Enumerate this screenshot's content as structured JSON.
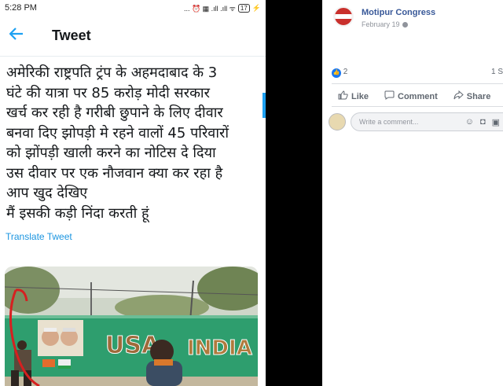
{
  "status_bar": {
    "time": "5:28 PM",
    "icons": "... ⏰ ▦ .ıll .ıll ᯤ",
    "battery": "17"
  },
  "twitter": {
    "header_title": "Tweet",
    "tweet_lines": [
      "अमेरिकी राष्ट्रपति ट्रंप के अहमदाबाद के 3",
      "घंटे की यात्रा पर 85 करोड़ मोदी सरकार",
      "खर्च कर रही है गरीबी छुपाने के लिए दीवार",
      "बनवा दिए झोपड़ी मे रहने वालों 45 परिवारों",
      "को झोंपड़ी खाली करने का नोटिस दे दिया",
      "उस दीवार पर एक नौजवान क्या कर रहा है",
      "आप खुद देखिए",
      "मैं इसकी कड़ी निंदा करती हूं"
    ],
    "translate_label": "Translate Tweet",
    "photo_wall_text": "USA INDIA"
  },
  "facebook": {
    "page_name": "Motipur Congress",
    "post_date": "February 19",
    "like_count": "2",
    "share_count": "1 S",
    "actions": {
      "like": "Like",
      "comment": "Comment",
      "share": "Share"
    },
    "comment_placeholder": "Write a comment..."
  },
  "colors": {
    "twitter_blue": "#1da1f2",
    "facebook_blue": "#385898",
    "wall_green": "#2e9e6e"
  }
}
